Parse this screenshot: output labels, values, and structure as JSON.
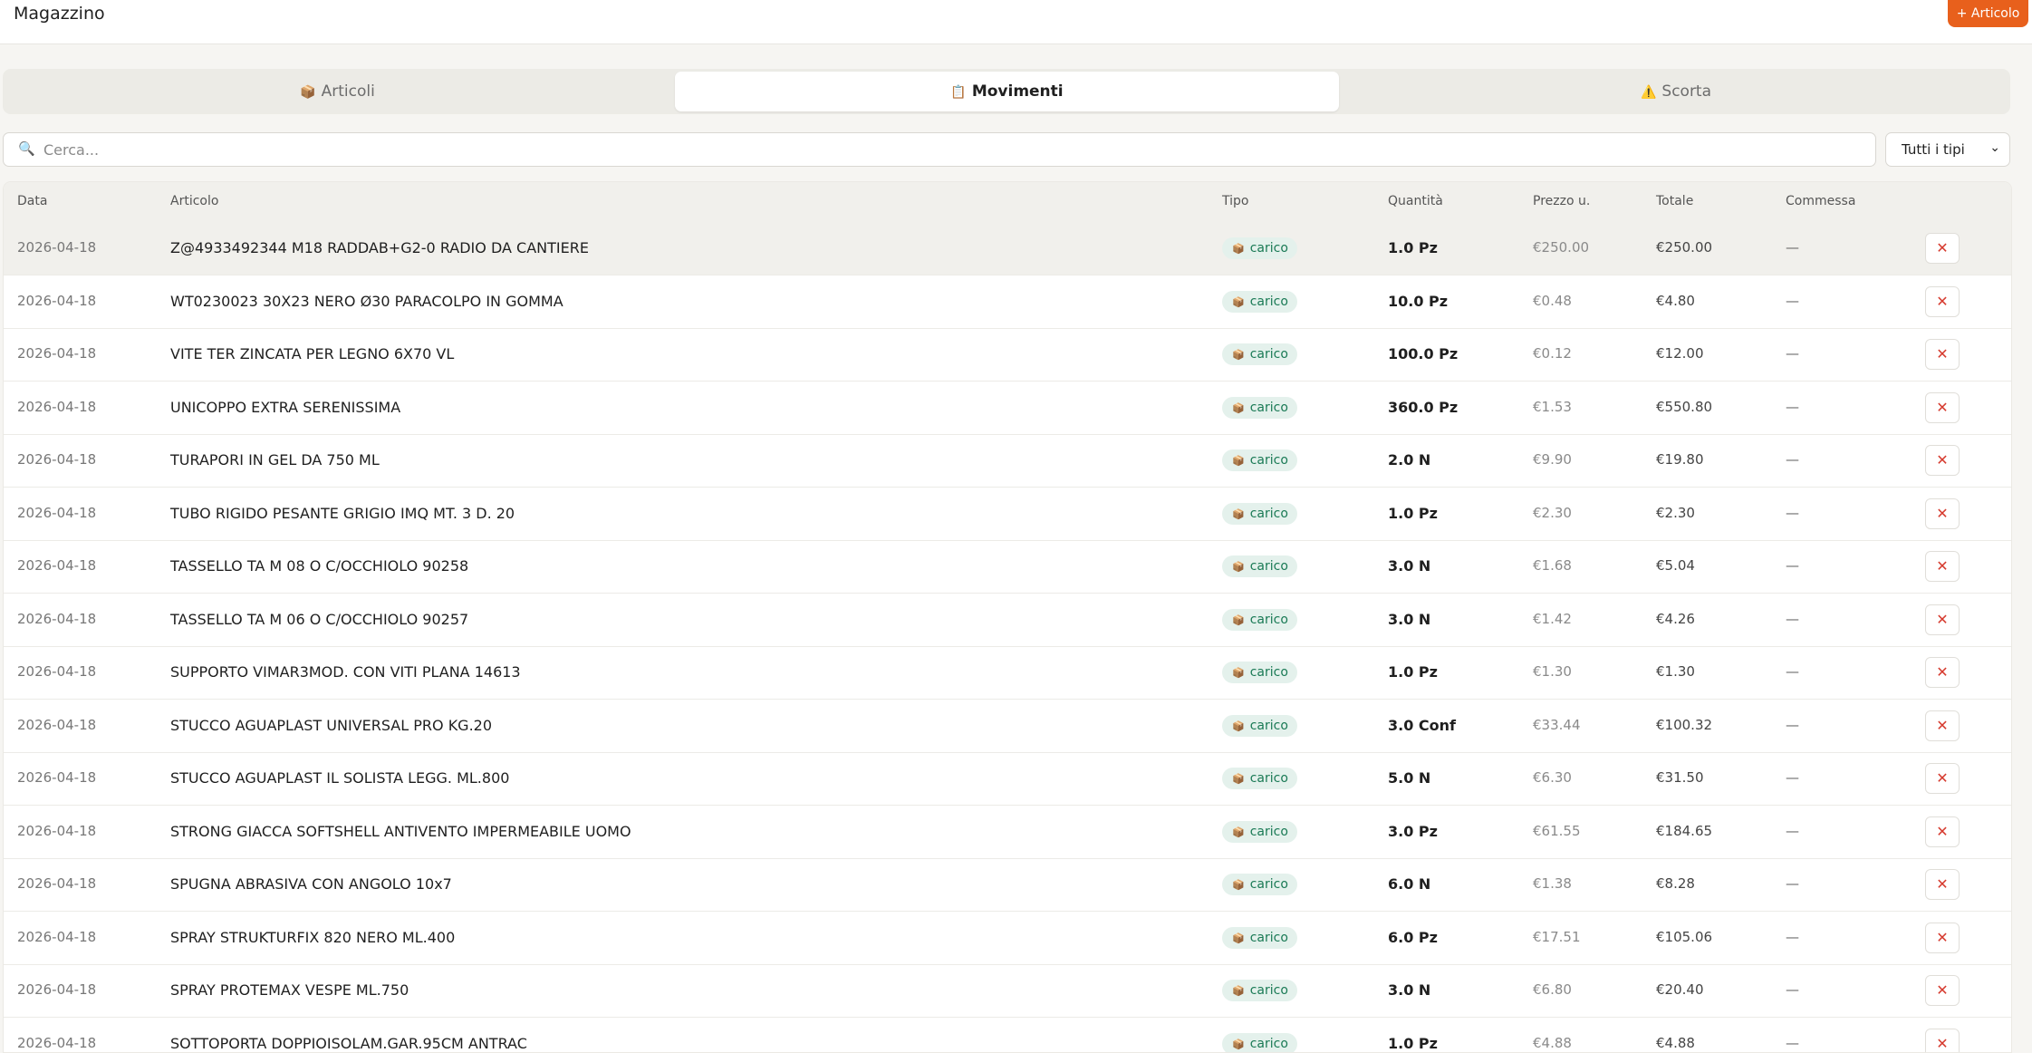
{
  "app": {
    "title": "Magazzino",
    "add_label": "+ Articolo"
  },
  "tabs": [
    {
      "icon": "📦",
      "label": "Articoli",
      "active": false
    },
    {
      "icon": "📋",
      "label": "Movimenti",
      "active": true
    },
    {
      "icon": "⚠️",
      "label": "Scorta",
      "active": false
    }
  ],
  "search": {
    "icon": "🔍",
    "placeholder": "Cerca..."
  },
  "filter": {
    "selected": "Tutti i tipi"
  },
  "table": {
    "headers": [
      "Data",
      "Articolo",
      "Tipo",
      "Quantità",
      "Prezzo u.",
      "Totale",
      "Commessa"
    ],
    "badge_icon": "📦",
    "delete_icon": "✕",
    "rows": [
      {
        "date": "2026-04-18",
        "article": "Z@4933492344 M18 RADDAB+G2-0 RADIO DA CANTIERE",
        "type": "carico",
        "qty": "1.0 Pz",
        "price": "€250.00",
        "total": "€250.00",
        "commessa": "—"
      },
      {
        "date": "2026-04-18",
        "article": "WT0230023 30X23 NERO Ø30 PARACOLPO IN GOMMA",
        "type": "carico",
        "qty": "10.0 Pz",
        "price": "€0.48",
        "total": "€4.80",
        "commessa": "—"
      },
      {
        "date": "2026-04-18",
        "article": "VITE TER ZINCATA PER LEGNO 6X70 VL",
        "type": "carico",
        "qty": "100.0 Pz",
        "price": "€0.12",
        "total": "€12.00",
        "commessa": "—"
      },
      {
        "date": "2026-04-18",
        "article": "UNICOPPO EXTRA SERENISSIMA",
        "type": "carico",
        "qty": "360.0 Pz",
        "price": "€1.53",
        "total": "€550.80",
        "commessa": "—"
      },
      {
        "date": "2026-04-18",
        "article": "TURAPORI IN GEL DA 750 ML",
        "type": "carico",
        "qty": "2.0 N",
        "price": "€9.90",
        "total": "€19.80",
        "commessa": "—"
      },
      {
        "date": "2026-04-18",
        "article": "TUBO RIGIDO PESANTE GRIGIO IMQ MT. 3 D. 20",
        "type": "carico",
        "qty": "1.0 Pz",
        "price": "€2.30",
        "total": "€2.30",
        "commessa": "—"
      },
      {
        "date": "2026-04-18",
        "article": "TASSELLO TA M 08 O C/OCCHIOLO 90258",
        "type": "carico",
        "qty": "3.0 N",
        "price": "€1.68",
        "total": "€5.04",
        "commessa": "—"
      },
      {
        "date": "2026-04-18",
        "article": "TASSELLO TA M 06 O C/OCCHIOLO 90257",
        "type": "carico",
        "qty": "3.0 N",
        "price": "€1.42",
        "total": "€4.26",
        "commessa": "—"
      },
      {
        "date": "2026-04-18",
        "article": "SUPPORTO VIMAR3MOD. CON VITI PLANA 14613",
        "type": "carico",
        "qty": "1.0 Pz",
        "price": "€1.30",
        "total": "€1.30",
        "commessa": "—"
      },
      {
        "date": "2026-04-18",
        "article": "STUCCO AGUAPLAST UNIVERSAL PRO KG.20",
        "type": "carico",
        "qty": "3.0 Conf",
        "price": "€33.44",
        "total": "€100.32",
        "commessa": "—"
      },
      {
        "date": "2026-04-18",
        "article": "STUCCO AGUAPLAST IL SOLISTA LEGG. ML.800",
        "type": "carico",
        "qty": "5.0 N",
        "price": "€6.30",
        "total": "€31.50",
        "commessa": "—"
      },
      {
        "date": "2026-04-18",
        "article": "STRONG GIACCA SOFTSHELL ANTIVENTO IMPERMEABILE UOMO",
        "type": "carico",
        "qty": "3.0 Pz",
        "price": "€61.55",
        "total": "€184.65",
        "commessa": "—"
      },
      {
        "date": "2026-04-18",
        "article": "SPUGNA ABRASIVA CON ANGOLO 10x7",
        "type": "carico",
        "qty": "6.0 N",
        "price": "€1.38",
        "total": "€8.28",
        "commessa": "—"
      },
      {
        "date": "2026-04-18",
        "article": "SPRAY STRUKTURFIX 820 NERO ML.400",
        "type": "carico",
        "qty": "6.0 Pz",
        "price": "€17.51",
        "total": "€105.06",
        "commessa": "—"
      },
      {
        "date": "2026-04-18",
        "article": "SPRAY PROTEMAX VESPE ML.750",
        "type": "carico",
        "qty": "3.0 N",
        "price": "€6.80",
        "total": "€20.40",
        "commessa": "—"
      },
      {
        "date": "2026-04-18",
        "article": "SOTTOPORTA DOPPIOISOLAM.GAR.95CM ANTRAC",
        "type": "carico",
        "qty": "1.0 Pz",
        "price": "€4.88",
        "total": "€4.88",
        "commessa": "—"
      }
    ]
  }
}
